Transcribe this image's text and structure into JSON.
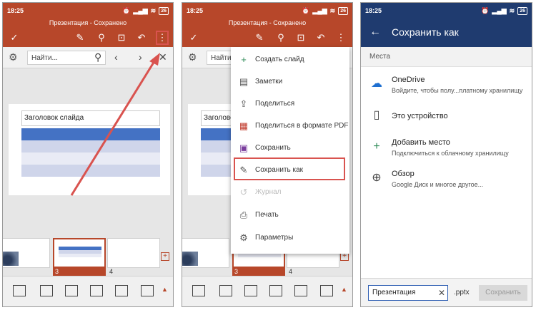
{
  "status": {
    "time": "18:25",
    "battery": "26"
  },
  "doc_title": "Презентация - Сохранено",
  "find": {
    "placeholder": "Найти..."
  },
  "slide": {
    "title": "Заголовок слайда"
  },
  "thumbs": {
    "num3": "3",
    "num4": "4"
  },
  "menu": {
    "items": [
      {
        "label": "Создать слайд",
        "icon": "plus-icon"
      },
      {
        "label": "Заметки",
        "icon": "notes-icon"
      },
      {
        "label": "Поделиться",
        "icon": "share-icon"
      },
      {
        "label": "Поделиться в формате PDF",
        "icon": "pdf-icon"
      },
      {
        "label": "Сохранить",
        "icon": "save-icon"
      },
      {
        "label": "Сохранить как",
        "icon": "save-as-icon"
      },
      {
        "label": "Журнал",
        "icon": "history-icon"
      },
      {
        "label": "Печать",
        "icon": "print-icon"
      },
      {
        "label": "Параметры",
        "icon": "gear-icon"
      }
    ]
  },
  "save_as": {
    "title": "Сохранить как",
    "section": "Места",
    "locations": [
      {
        "title": "OneDrive",
        "subtitle": "Войдите, чтобы полу...платному хранилищу",
        "icon": "cloud-icon"
      },
      {
        "title": "Это устройство",
        "subtitle": "",
        "icon": "phone-icon"
      },
      {
        "title": "Добавить место",
        "subtitle": "Подключиться к облачному хранилищу",
        "icon": "plus-icon"
      },
      {
        "title": "Обзор",
        "subtitle": "Google Диск и многое другое...",
        "icon": "globe-icon"
      }
    ],
    "filename": "Презентация",
    "extension": ".pptx",
    "save_label": "Сохранить"
  },
  "colors": {
    "accent": "#b7472a",
    "highlight": "#d9534f",
    "dialog_header": "#1f3b6f"
  }
}
